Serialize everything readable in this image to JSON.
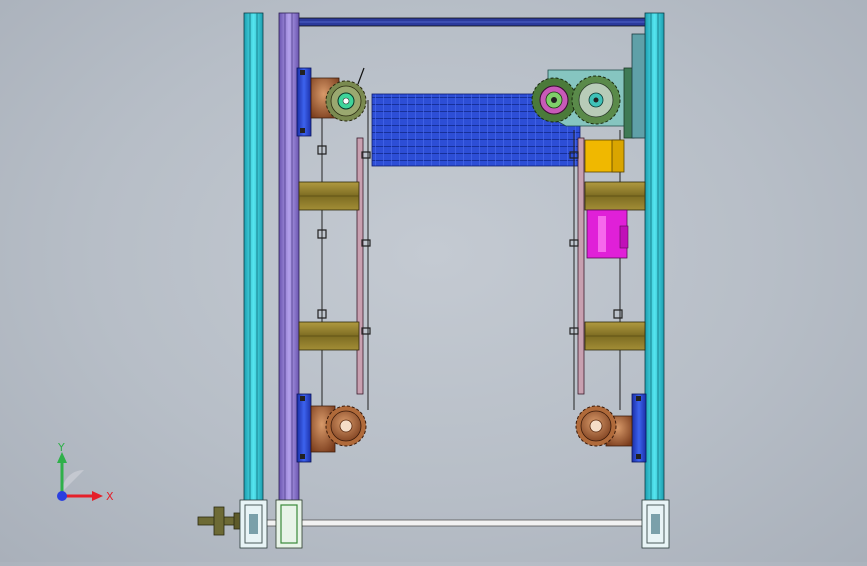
{
  "viewport": {
    "background": "#b9c0c9"
  },
  "triad": {
    "x_label": "X",
    "y_label": "Y",
    "x_color": "#e5202a",
    "y_color": "#2fb04a",
    "z_color": "#2a3fe0"
  },
  "colors": {
    "frame_cyan": "#3fd4e0",
    "frame_violet": "#9a82d6",
    "beam_navy": "#2b3a9c",
    "slat_blue": "#2e4fd8",
    "bracket_brown": "#a0522d",
    "block_olive": "#8a7a2a",
    "gear_green": "#4b7a3a",
    "motor_yellow": "#f0b800",
    "motor_magenta": "#e020d8",
    "shaft_white": "#f2f2f2"
  }
}
